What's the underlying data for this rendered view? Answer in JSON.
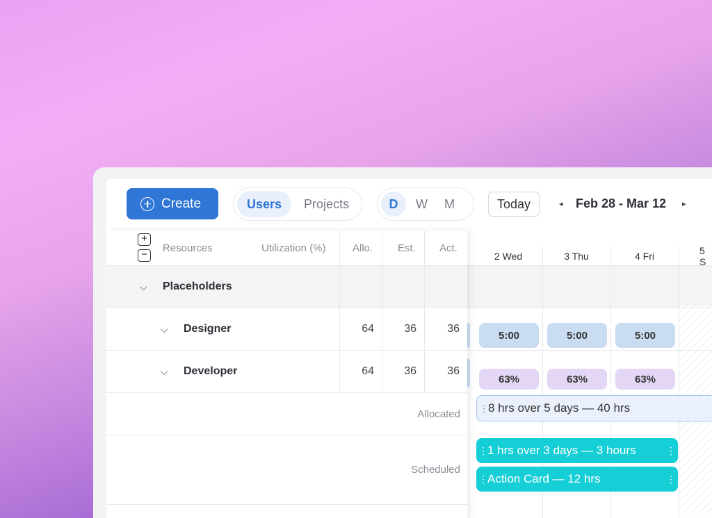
{
  "toolbar": {
    "create_label": "Create",
    "view_tabs": [
      {
        "label": "Users",
        "active": true
      },
      {
        "label": "Projects",
        "active": false
      }
    ],
    "period_tabs": [
      {
        "label": "D",
        "active": true
      },
      {
        "label": "W",
        "active": false
      },
      {
        "label": "M",
        "active": false
      }
    ],
    "today_label": "Today",
    "date_range": "Feb 28 - Mar 12",
    "prev_arrow": "◂",
    "next_arrow": "▸"
  },
  "table": {
    "expand_symbol": "+",
    "collapse_symbol": "−",
    "headers": {
      "resources": "Resources",
      "utilization": "Utilization (%)",
      "allocated": "Allo.",
      "estimated": "Est.",
      "actual": "Act."
    },
    "group": {
      "label": "Placeholders"
    },
    "rows": [
      {
        "label": "Designer",
        "allocated": "64",
        "estimated": "36",
        "actual": "36"
      },
      {
        "label": "Developer",
        "allocated": "64",
        "estimated": "36",
        "actual": "36"
      }
    ],
    "summary": {
      "allocated_label": "Allocated",
      "scheduled_label": "Scheduled"
    }
  },
  "timeline": {
    "days": [
      "2 Wed",
      "3 Thu",
      "4 Fri",
      "5 S"
    ],
    "designer_hours": [
      "5:00",
      "5:00",
      "5:00"
    ],
    "developer_util": [
      "63%",
      "63%",
      "63%"
    ],
    "allocated_bar": "8 hrs over 5 days — 40 hrs",
    "scheduled_bars": [
      "1 hrs over 3 days — 3 hours",
      "Action Card — 12 hrs"
    ]
  },
  "colors": {
    "accent": "#2f76d6",
    "scheduled": "#16cfd6",
    "hours_pill": "#c9dcf2",
    "util_pill": "#e3d7f5"
  }
}
